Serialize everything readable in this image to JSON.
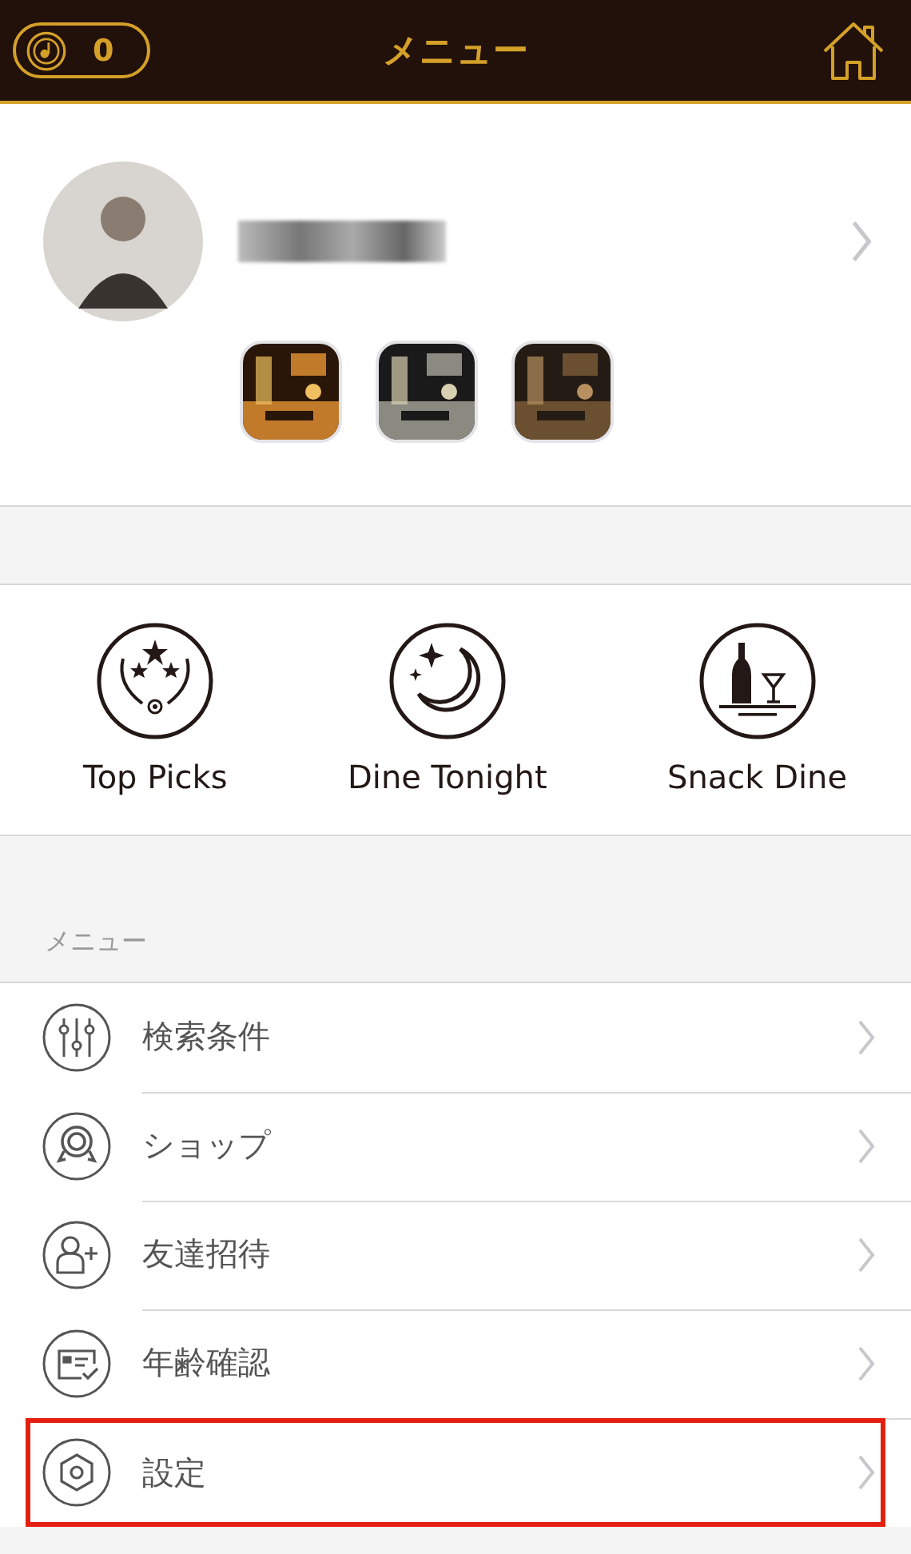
{
  "header": {
    "points": "0",
    "title": "メニュー"
  },
  "categories": [
    {
      "kind": "laurel",
      "label": "Top Picks"
    },
    {
      "kind": "moon",
      "label": "Dine Tonight"
    },
    {
      "kind": "bottle",
      "label": "Snack Dine"
    }
  ],
  "menu": {
    "heading": "メニュー",
    "items": [
      {
        "kind": "sliders",
        "label": "検索条件",
        "highlighted": false
      },
      {
        "kind": "badge",
        "label": "ショップ",
        "highlighted": false
      },
      {
        "kind": "person-plus",
        "label": "友達招待",
        "highlighted": false
      },
      {
        "kind": "id-card",
        "label": "年齢確認",
        "highlighted": false
      },
      {
        "kind": "hexagon",
        "label": "設定",
        "highlighted": true
      }
    ]
  }
}
